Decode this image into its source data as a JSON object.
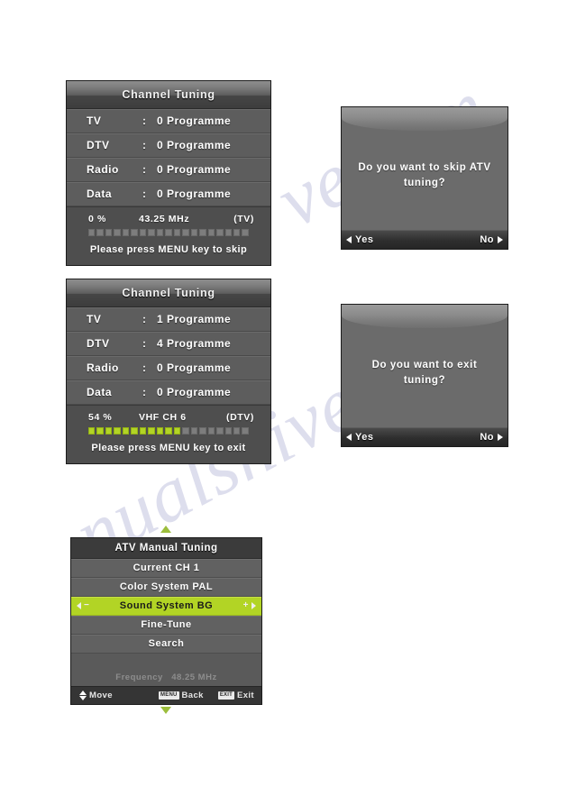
{
  "watermark": {
    "line1": "ve.com",
    "line2": "nualshive"
  },
  "colors": {
    "osd_background": "#5a5a5a",
    "highlight_green": "#b2d425",
    "progress_filled": "#b2d425",
    "progress_empty": "#7d7d7d",
    "dialog_background": "#6b6b6b"
  },
  "panels": {
    "channel_tuning_start": {
      "title": "Channel Tuning",
      "rows": [
        {
          "label": "TV",
          "colon": ":",
          "value": "0 Programme"
        },
        {
          "label": "DTV",
          "colon": ":",
          "value": "0 Programme"
        },
        {
          "label": "Radio",
          "colon": ":",
          "value": "0 Programme"
        },
        {
          "label": "Data",
          "colon": ":",
          "value": "0 Programme"
        }
      ],
      "status": {
        "percent": "0  %",
        "band": "43.25 MHz",
        "mode": "(TV)"
      },
      "progress": {
        "total_segments": 19,
        "filled_segments": 0,
        "percent_value": 0
      },
      "hint": "Please press MENU key to skip"
    },
    "channel_tuning_progress": {
      "title": "Channel Tuning",
      "rows": [
        {
          "label": "TV",
          "colon": ":",
          "value": "1 Programme"
        },
        {
          "label": "DTV",
          "colon": ":",
          "value": "4 Programme"
        },
        {
          "label": "Radio",
          "colon": ":",
          "value": "0 Programme"
        },
        {
          "label": "Data",
          "colon": ":",
          "value": "0 Programme"
        }
      ],
      "status": {
        "percent": "54 %",
        "band": "VHF  CH  6",
        "mode": "(DTV)"
      },
      "progress": {
        "total_segments": 19,
        "filled_segments": 11,
        "percent_value": 54
      },
      "hint": "Please press MENU key to exit"
    },
    "skip_atv_dialog": {
      "message": "Do you want to skip ATV tuning?",
      "yes_label": "Yes",
      "no_label": "No"
    },
    "exit_tuning_dialog": {
      "message": "Do you want to exit tuning?",
      "yes_label": "Yes",
      "no_label": "No"
    },
    "atv_manual_tuning": {
      "title": "ATV Manual Tuning",
      "items": [
        {
          "label": "Current CH 1",
          "selected": false
        },
        {
          "label": "Color System PAL",
          "selected": false
        },
        {
          "label": "Sound System BG",
          "selected": true
        },
        {
          "label": "Fine-Tune",
          "selected": false
        },
        {
          "label": "Search",
          "selected": false
        }
      ],
      "adjust": {
        "minus": "−",
        "plus": "+"
      },
      "frequency_label": "Frequency",
      "frequency_value": "48.25 MHz",
      "footer": {
        "move_label": "Move",
        "back_key": "MENU",
        "back_label": "Back",
        "exit_key": "EXIT",
        "exit_label": "Exit"
      }
    }
  }
}
